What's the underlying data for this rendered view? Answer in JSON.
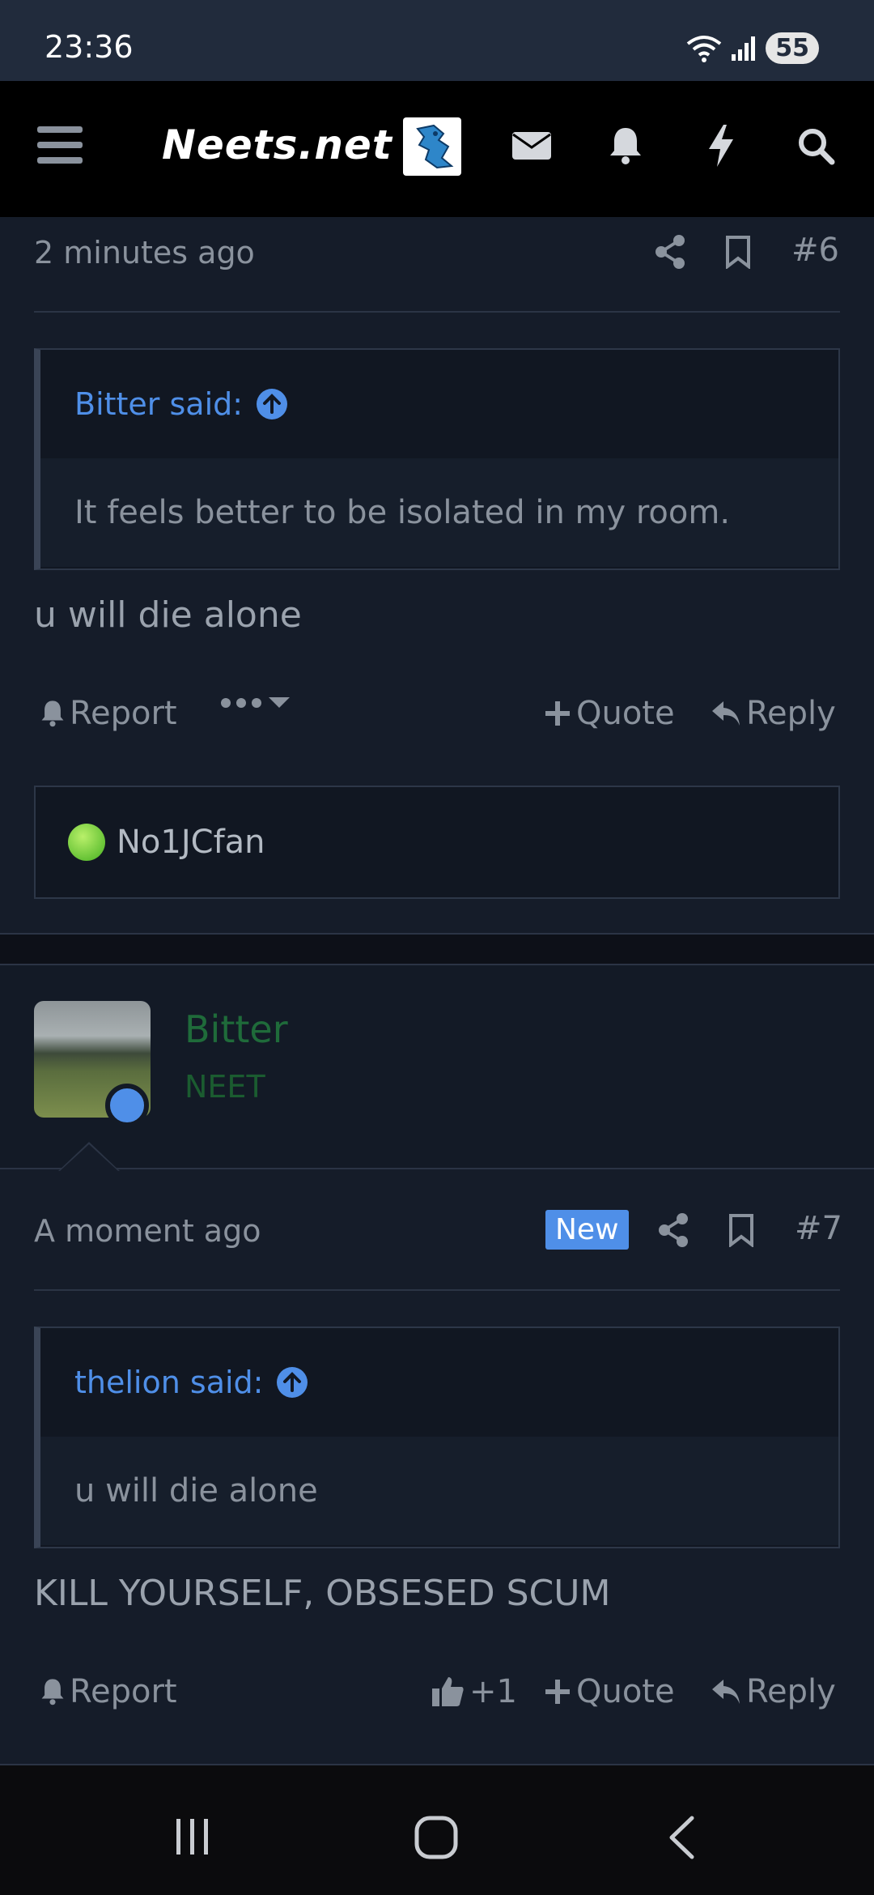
{
  "status_bar": {
    "time": "23:36",
    "battery": "55"
  },
  "navbar": {
    "logo": "Neets.net"
  },
  "post6": {
    "time": "2 minutes ago",
    "number": "#6",
    "quote_author": "Bitter said:",
    "quote_text": "It feels better to be isolated in my room.",
    "text": "u will die alone",
    "report": "Report",
    "quote": "Quote",
    "reply": "Reply",
    "reaction_user": "No1JCfan"
  },
  "post7": {
    "username": "Bitter",
    "user_title": "NEET",
    "time": "A moment ago",
    "badge": "New",
    "number": "#7",
    "quote_author": "thelion said:",
    "quote_text": "u will die alone",
    "text": "KILL YOURSELF, OBSESED SCUM",
    "report": "Report",
    "like_count": "+1",
    "quote": "Quote",
    "reply": "Reply"
  },
  "colors": {
    "accent": "#4f8fe8",
    "username": "#1f6b3a",
    "background": "#151c29"
  }
}
